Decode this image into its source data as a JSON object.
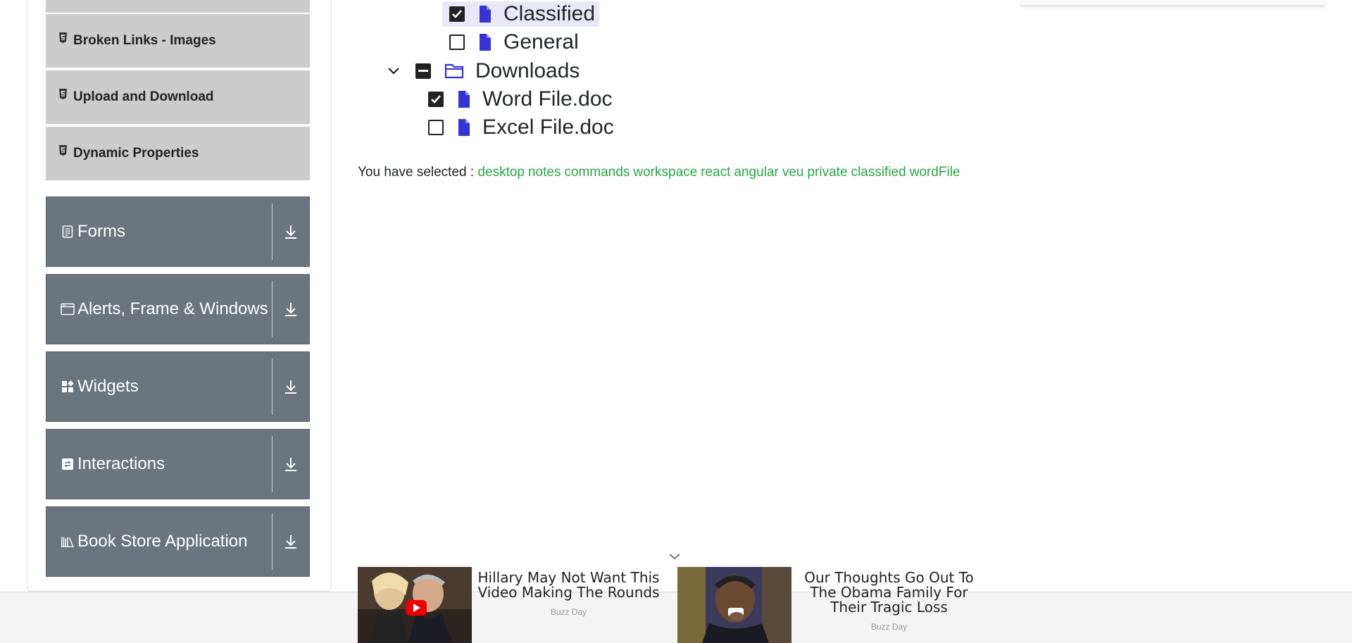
{
  "sidebar": {
    "sub_items": [
      {
        "label": "Broken Links - Images"
      },
      {
        "label": "Upload and Download"
      },
      {
        "label": "Dynamic Properties"
      }
    ],
    "groups": [
      {
        "label": "Forms",
        "icon": "form-icon"
      },
      {
        "label": "Alerts, Frame & Windows",
        "icon": "window-icon"
      },
      {
        "label": "Widgets",
        "icon": "widgets-icon"
      },
      {
        "label": "Interactions",
        "icon": "interactions-icon"
      },
      {
        "label": "Book Store Application",
        "icon": "books-icon"
      }
    ]
  },
  "tree": {
    "nodes": [
      {
        "label": "Classified",
        "type": "file",
        "checked": true,
        "highlighted": true
      },
      {
        "label": "General",
        "type": "file",
        "checked": false
      },
      {
        "label": "Downloads",
        "type": "folder",
        "state": "half",
        "expanded": true
      },
      {
        "label": "Word File.doc",
        "type": "file",
        "checked": true
      },
      {
        "label": "Excel File.doc",
        "type": "file",
        "checked": false
      }
    ]
  },
  "result": {
    "prefix": "You have selected :",
    "items": [
      "desktop",
      "notes",
      "commands",
      "workspace",
      "react",
      "angular",
      "veu",
      "private",
      "classified",
      "wordFile"
    ]
  },
  "ads": [
    {
      "title": "Hillary May Not Want This Video Making The Rounds",
      "source": "Buzz Day"
    },
    {
      "title": "Our Thoughts Go Out To The Obama Family For Their Tragic Loss",
      "source": "Buzz Day"
    }
  ],
  "colors": {
    "group_bg": "#6c757d",
    "sub_item_bg": "#cccccc",
    "selected_text": "#28a745",
    "file_icon": "#3434d6"
  }
}
